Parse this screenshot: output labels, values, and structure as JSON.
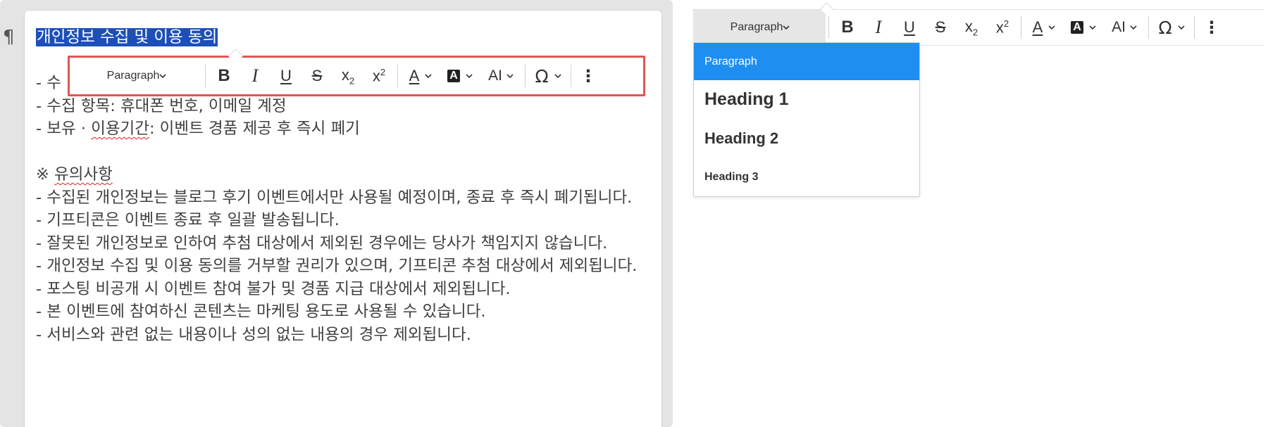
{
  "editor": {
    "pilcrow": "¶",
    "title": "개인정보 수집 및 이용 동의",
    "lines": [
      "- 수",
      "- 수집 항목: 휴대폰 번호, 이메일 계정",
      "- 보유 · ",
      "이용기간",
      ": 이벤트 경품 제공 후 즉시 폐기",
      "※ ",
      "유의사항",
      "- 수집된 개인정보는 블로그 후기 이벤트에서만 사용될 예정이며, 종료 후 즉시 폐기됩니다.",
      "- 기프티콘은 이벤트 종료 후 일괄 발송됩니다.",
      "- 잘못된 개인정보로 인하여 추첨 대상에서 제외된 경우에는 당사가 책임지지 않습니다.",
      "- 개인정보 수집 및 이용 동의를 거부할 권리가 있으며, 기프티콘 추첨 대상에서 제외됩니다.",
      "- 포스팅 비공개 시 이벤트 참여 불가 및 경품 지급 대상에서 제외됩니다.",
      "- 본 이벤트에 참여하신 콘텐츠는 마케팅 용도로 사용될 수 있습니다.",
      "- 서비스와 관련 없는 내용이나 성의 없는 내용의 경우 제외됩니다."
    ]
  },
  "toolbar": {
    "paragraph_label": "Paragraph",
    "bold": "B",
    "italic": "I",
    "underline": "U",
    "strike": "S",
    "subscript_base": "x",
    "subscript_mark": "2",
    "superscript_base": "x",
    "superscript_mark": "2",
    "font_color": "A",
    "bg_color": "A",
    "font_size": "AI",
    "special_chars": "Ω",
    "more": "⋮"
  },
  "dropdown": {
    "items": [
      "Paragraph",
      "Heading 1",
      "Heading 2",
      "Heading 3"
    ],
    "selected": "Paragraph"
  },
  "colors": {
    "highlight_border": "#e05555",
    "selection": "#1d4fb8",
    "dropdown_active": "#1e8ef1"
  }
}
